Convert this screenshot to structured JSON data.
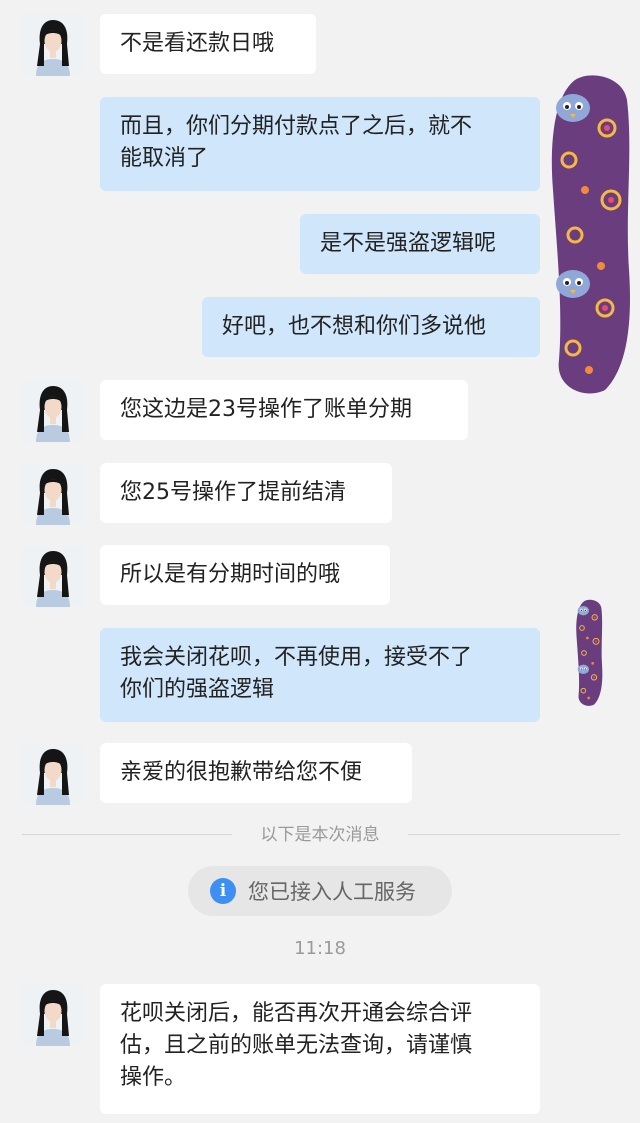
{
  "messages": [
    {
      "from": "agent",
      "text": "不是看还款日哦"
    },
    {
      "from": "user",
      "text": "而且，你们分期付款点了之后，就不\n能取消了"
    },
    {
      "from": "user",
      "text": "是不是强盗逻辑呢"
    },
    {
      "from": "user",
      "text": "好吧，也不想和你们多说他"
    },
    {
      "from": "agent",
      "text": "您这边是23号操作了账单分期"
    },
    {
      "from": "agent",
      "text": "您25号操作了提前结清"
    },
    {
      "from": "agent",
      "text": "所以是有分期时间的哦"
    },
    {
      "from": "user",
      "text": "我会关闭花呗，不再使用，接受不了\n你们的强盗逻辑"
    },
    {
      "from": "agent",
      "text": "亲爱的很抱歉带给您不便"
    },
    {
      "from": "agent",
      "text": "花呗关闭后，能否再次开通会综合评\n估，且之前的账单无法查询，请谨慎\n操作。"
    }
  ],
  "divider": {
    "text": "以下是本次消息"
  },
  "notice": {
    "icon": "info-icon",
    "text": "您已接入人工服务"
  },
  "timestamp": "11:18",
  "colors": {
    "background": "#f2f2f2",
    "incoming_bubble": "#ffffff",
    "outgoing_bubble": "#cfe6fb",
    "sticker": "#6a3d7f",
    "info_icon": "#3d8ff2"
  }
}
